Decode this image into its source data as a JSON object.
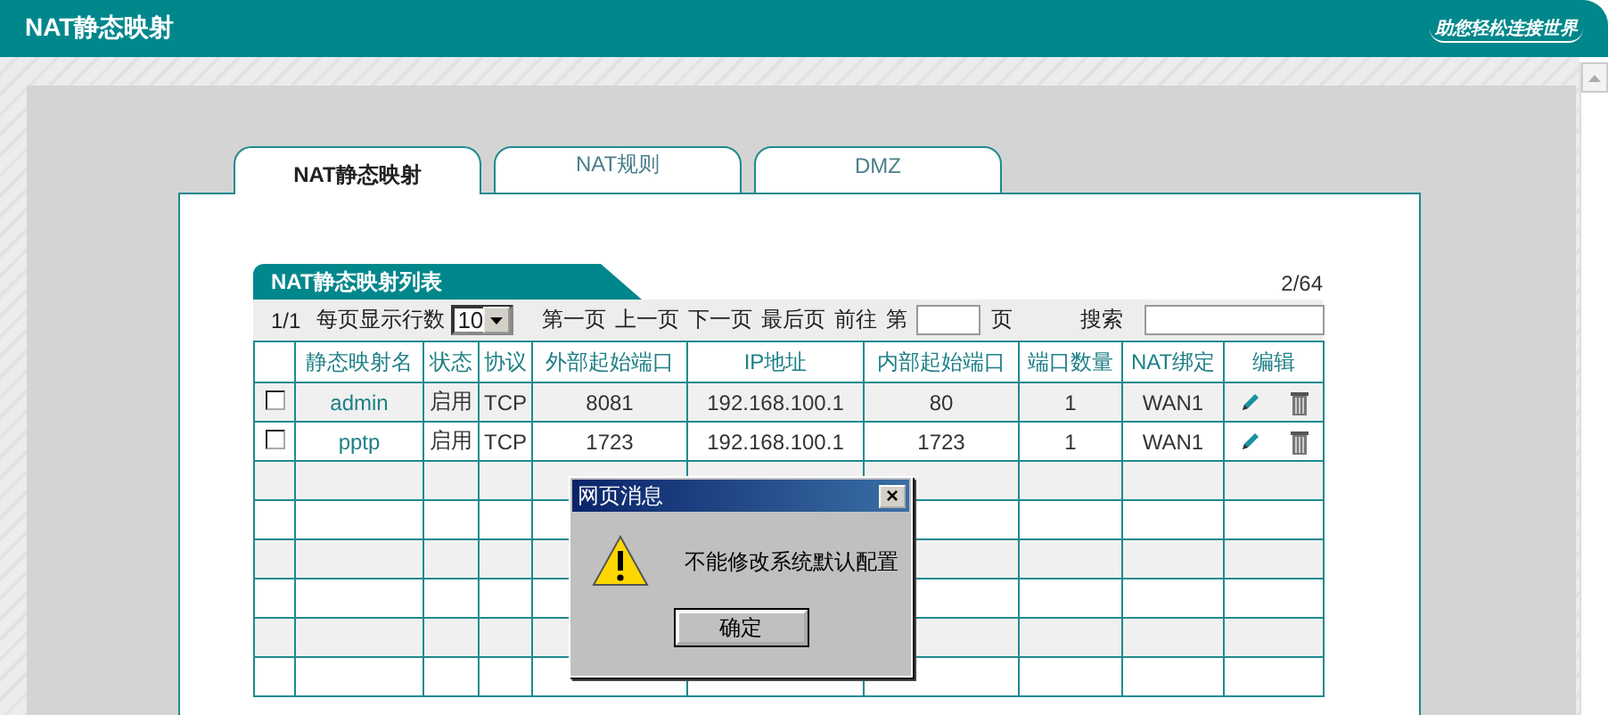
{
  "header": {
    "title": "NAT静态映射",
    "slogan": "助您轻松连接世界"
  },
  "tabs": [
    {
      "label": "NAT静态映射",
      "selected": true
    },
    {
      "label": "NAT规则",
      "selected": false
    },
    {
      "label": "DMZ",
      "selected": false
    }
  ],
  "list": {
    "title": "NAT静态映射列表",
    "count": "2/64",
    "page": "1/1",
    "rows_per_page_label": "每页显示行数",
    "rows_per_page": "10",
    "nav": [
      "第一页",
      "上一页",
      "下一页",
      "最后页"
    ],
    "goto": "前往",
    "page_prefix": "第",
    "page_suffix": "页",
    "search_label": "搜索"
  },
  "table": {
    "columns": [
      "静态映射名",
      "状态",
      "协议",
      "外部起始端口",
      "IP地址",
      "内部起始端口",
      "端口数量",
      "NAT绑定",
      "编辑"
    ],
    "rows": [
      {
        "checked": false,
        "name": "admin",
        "status": "启用",
        "protocol": "TCP",
        "ext_port": "8081",
        "ip": "192.168.100.1",
        "int_port": "80",
        "count": "1",
        "binding": "WAN1"
      },
      {
        "checked": false,
        "name": "pptp",
        "status": "启用",
        "protocol": "TCP",
        "ext_port": "1723",
        "ip": "192.168.100.1",
        "int_port": "1723",
        "count": "1",
        "binding": "WAN1"
      }
    ]
  },
  "dialog": {
    "title": "网页消息",
    "close": "×",
    "message": "不能修改系统默认配置",
    "button": "确定"
  }
}
